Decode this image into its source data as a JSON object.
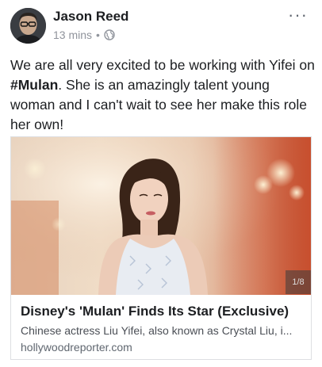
{
  "post": {
    "author": "Jason Reed",
    "time": "13 mins",
    "separator": "•",
    "privacy_icon": "globe-icon",
    "more_label": "···",
    "text_before": "We are all very excited to be working with Yifei on ",
    "hashtag": "#Mulan",
    "text_after": ".  She is an amazingly talent young woman and I can't wait to see her make this role her own!"
  },
  "link_card": {
    "title": "Disney's 'Mulan' Finds Its Star (Exclusive)",
    "description": "Chinese actress Liu Yifei, also known as Crystal Liu, i...",
    "domain": "hollywoodreporter.com",
    "counter": "1/8"
  },
  "colors": {
    "text": "#1c1e21",
    "meta": "#90949c",
    "border": "#dddfe2"
  }
}
